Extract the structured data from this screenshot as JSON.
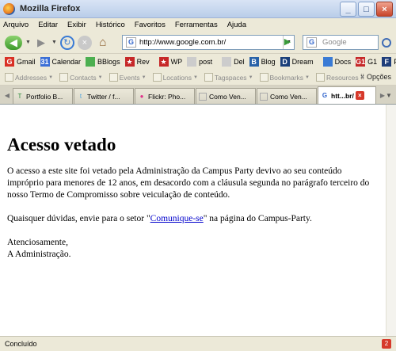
{
  "window": {
    "title": "Mozilla Firefox"
  },
  "menu": [
    "Arquivo",
    "Editar",
    "Exibir",
    "Histórico",
    "Favoritos",
    "Ferramentas",
    "Ajuda"
  ],
  "navigation": {
    "url": "http://www.google.com.br/",
    "search_placeholder": "Google"
  },
  "bookmarks": [
    {
      "label": "Gmail",
      "color": "#d93025",
      "icon": "G"
    },
    {
      "label": "Calendar",
      "color": "#3b6fd6",
      "icon": "31"
    },
    {
      "label": "BBlogs",
      "color": "#4caf50",
      "icon": ""
    },
    {
      "label": "Rev",
      "color": "#c62828",
      "icon": "★"
    },
    {
      "label": "WP",
      "color": "#c62828",
      "icon": "★"
    },
    {
      "label": "post",
      "color": "#cccccc",
      "icon": ""
    },
    {
      "label": "Del",
      "color": "#cccccc",
      "icon": ""
    },
    {
      "label": "Blog",
      "color": "#2962a8",
      "icon": "B"
    },
    {
      "label": "Dream",
      "color": "#1a3f7a",
      "icon": "D"
    },
    {
      "label": "Docs",
      "color": "#3a7bd5",
      "icon": ""
    },
    {
      "label": "G1",
      "color": "#c62828",
      "icon": "G1"
    },
    {
      "label": "Folha",
      "color": "#1f3e7a",
      "icon": "F"
    }
  ],
  "tagspaces": {
    "items": [
      "Addresses",
      "Contacts",
      "Events",
      "Locations",
      "Tagspaces",
      "Bookmarks",
      "Resources"
    ],
    "options_label": "Opções"
  },
  "tabs": [
    {
      "label": "Portfolio B...",
      "icon": "T",
      "icon_color": "#2a8a3a",
      "active": false
    },
    {
      "label": "Twitter / f...",
      "icon": "t",
      "icon_color": "#4aa3df",
      "active": false
    },
    {
      "label": "Flickr: Pho...",
      "icon": "●",
      "icon_color": "#e0338a",
      "active": false
    },
    {
      "label": "Como Ven...",
      "icon": "",
      "icon_color": "#cccccc",
      "active": false
    },
    {
      "label": "Como Ven...",
      "icon": "",
      "icon_color": "#cccccc",
      "active": false
    },
    {
      "label": "htt...br/",
      "icon": "G",
      "icon_color": "#3366cc",
      "active": true
    }
  ],
  "page": {
    "heading": "Acesso vetado",
    "paragraph1": "O acesso a este site foi vetado pela Administração da Campus Party devivo ao seu conteúdo impróprio para menores de 12 anos, em desacordo com a cláusula segunda no parágrafo terceiro do nosso Termo de Compromisso sobre veiculação de conteúdo.",
    "paragraph2_before": "Quaisquer dúvidas, envie para o setor \"",
    "link_text": "Comunique-se",
    "paragraph2_after": "\" na página do Campus-Party.",
    "closing1": "Atenciosamente,",
    "closing2": "A Administração."
  },
  "status": {
    "text": "Concluído",
    "count": "2"
  }
}
